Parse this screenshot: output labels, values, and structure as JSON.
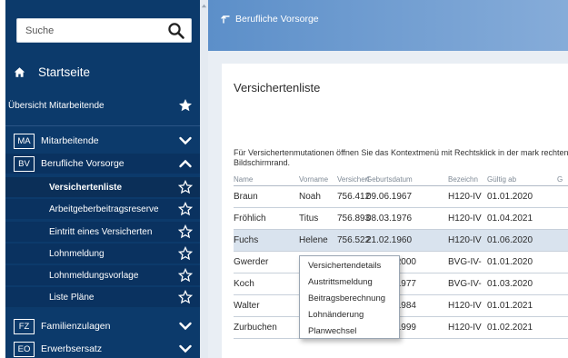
{
  "search": {
    "placeholder": "Suche"
  },
  "sidebar": {
    "home_label": "Startseite",
    "overview_label": "Übersicht Mitarbeitende",
    "groups": [
      {
        "badge": "MA",
        "label": "Mitarbeitende"
      },
      {
        "badge": "BV",
        "label": "Berufliche Vorsorge"
      }
    ],
    "sub_items": [
      {
        "label": "Versichertenliste"
      },
      {
        "label": "Arbeitgeberbeitragsreserve"
      },
      {
        "label": "Eintritt eines Versicherten"
      },
      {
        "label": "Lohnmeldung"
      },
      {
        "label": "Lohnmeldungsvorlage"
      },
      {
        "label": "Liste Pläne"
      }
    ],
    "bottom_groups": [
      {
        "badge": "FZ",
        "label": "Familienzulagen"
      },
      {
        "badge": "EO",
        "label": "Erwerbsersatz"
      }
    ]
  },
  "header": {
    "breadcrumb": "Berufliche Vorsorge"
  },
  "main": {
    "title": "Versichertenliste",
    "notice": "Für Versichertenmutationen öffnen Sie das Kontextmenü mit Rechtsklick in der mark rechten Bildschirmrand.",
    "table": {
      "columns": [
        "Name",
        "Vorname",
        "Versichert",
        "Geburtsdatum",
        "Bezeichn",
        "Gültig ab",
        "G"
      ],
      "rows": [
        [
          "Braun",
          "Noah",
          "756.412",
          "09.06.1967",
          "H120-IV",
          "01.01.2020",
          ""
        ],
        [
          "Fröhlich",
          "Titus",
          "756.893",
          "08.03.1976",
          "H120-IV",
          "01.04.2021",
          ""
        ],
        [
          "Fuchs",
          "Helene",
          "756.522",
          "21.02.1960",
          "H120-IV",
          "01.06.2020",
          ""
        ],
        [
          "Gwerder",
          "",
          "",
          "2000",
          "BVG-IV-",
          "01.01.2020",
          ""
        ],
        [
          "Koch",
          "",
          "",
          "1977",
          "BVG-IV-",
          "01.03.2020",
          ""
        ],
        [
          "Walter",
          "",
          "",
          "1984",
          "H120-IV",
          "01.01.2021",
          ""
        ],
        [
          "Zurbuchen",
          "",
          "",
          "1999",
          "H120-IV",
          "01.02.2021",
          ""
        ]
      ],
      "selected_row": 2
    }
  },
  "context_menu": {
    "items": [
      "Versichertendetails",
      "Austrittsmeldung",
      "Beitragsberechnung",
      "Lohnänderung",
      "Planwechsel"
    ]
  },
  "colors": {
    "sidebar_bg": "#0c3a6b",
    "header_gradient_start": "#5c8fc9",
    "header_gradient_end": "#86acd9",
    "selected_row": "#d9e3ee"
  },
  "icons": {
    "search": "search-icon",
    "home": "home-icon",
    "star_filled": "star-filled-icon",
    "star_outline": "star-outline-icon",
    "chevron_down": "chevron-down-icon",
    "chevron_up": "chevron-up-icon",
    "back": "back-arrow-icon"
  }
}
